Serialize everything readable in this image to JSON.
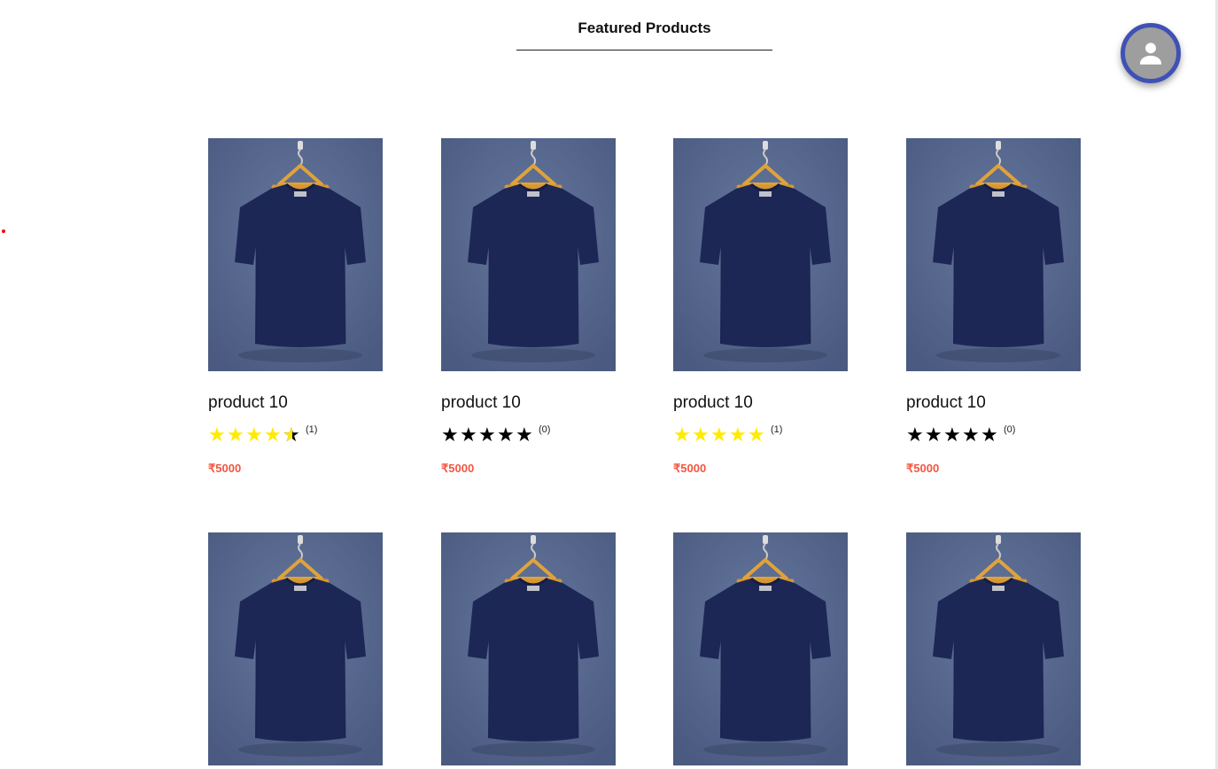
{
  "section": {
    "title": "Featured Products"
  },
  "colors": {
    "accent": "#3f51b5",
    "price": "#f4553f",
    "star_filled": "#ffeb00",
    "star_empty": "#000000",
    "background_image": "#5a6a90",
    "shirt": "#1c2756"
  },
  "account_button": {
    "icon": "person-icon"
  },
  "products": [
    {
      "name": "product 10",
      "rating": 4.5,
      "review_count": "(1)",
      "price": "₹5000"
    },
    {
      "name": "product 10",
      "rating": 0,
      "review_count": "(0)",
      "price": "₹5000"
    },
    {
      "name": "product 10",
      "rating": 5,
      "review_count": "(1)",
      "price": "₹5000"
    },
    {
      "name": "product 10",
      "rating": 0,
      "review_count": "(0)",
      "price": "₹5000"
    },
    {
      "name": "",
      "rating": null,
      "review_count": "",
      "price": ""
    },
    {
      "name": "",
      "rating": null,
      "review_count": "",
      "price": ""
    },
    {
      "name": "",
      "rating": null,
      "review_count": "",
      "price": ""
    },
    {
      "name": "",
      "rating": null,
      "review_count": "",
      "price": ""
    }
  ]
}
